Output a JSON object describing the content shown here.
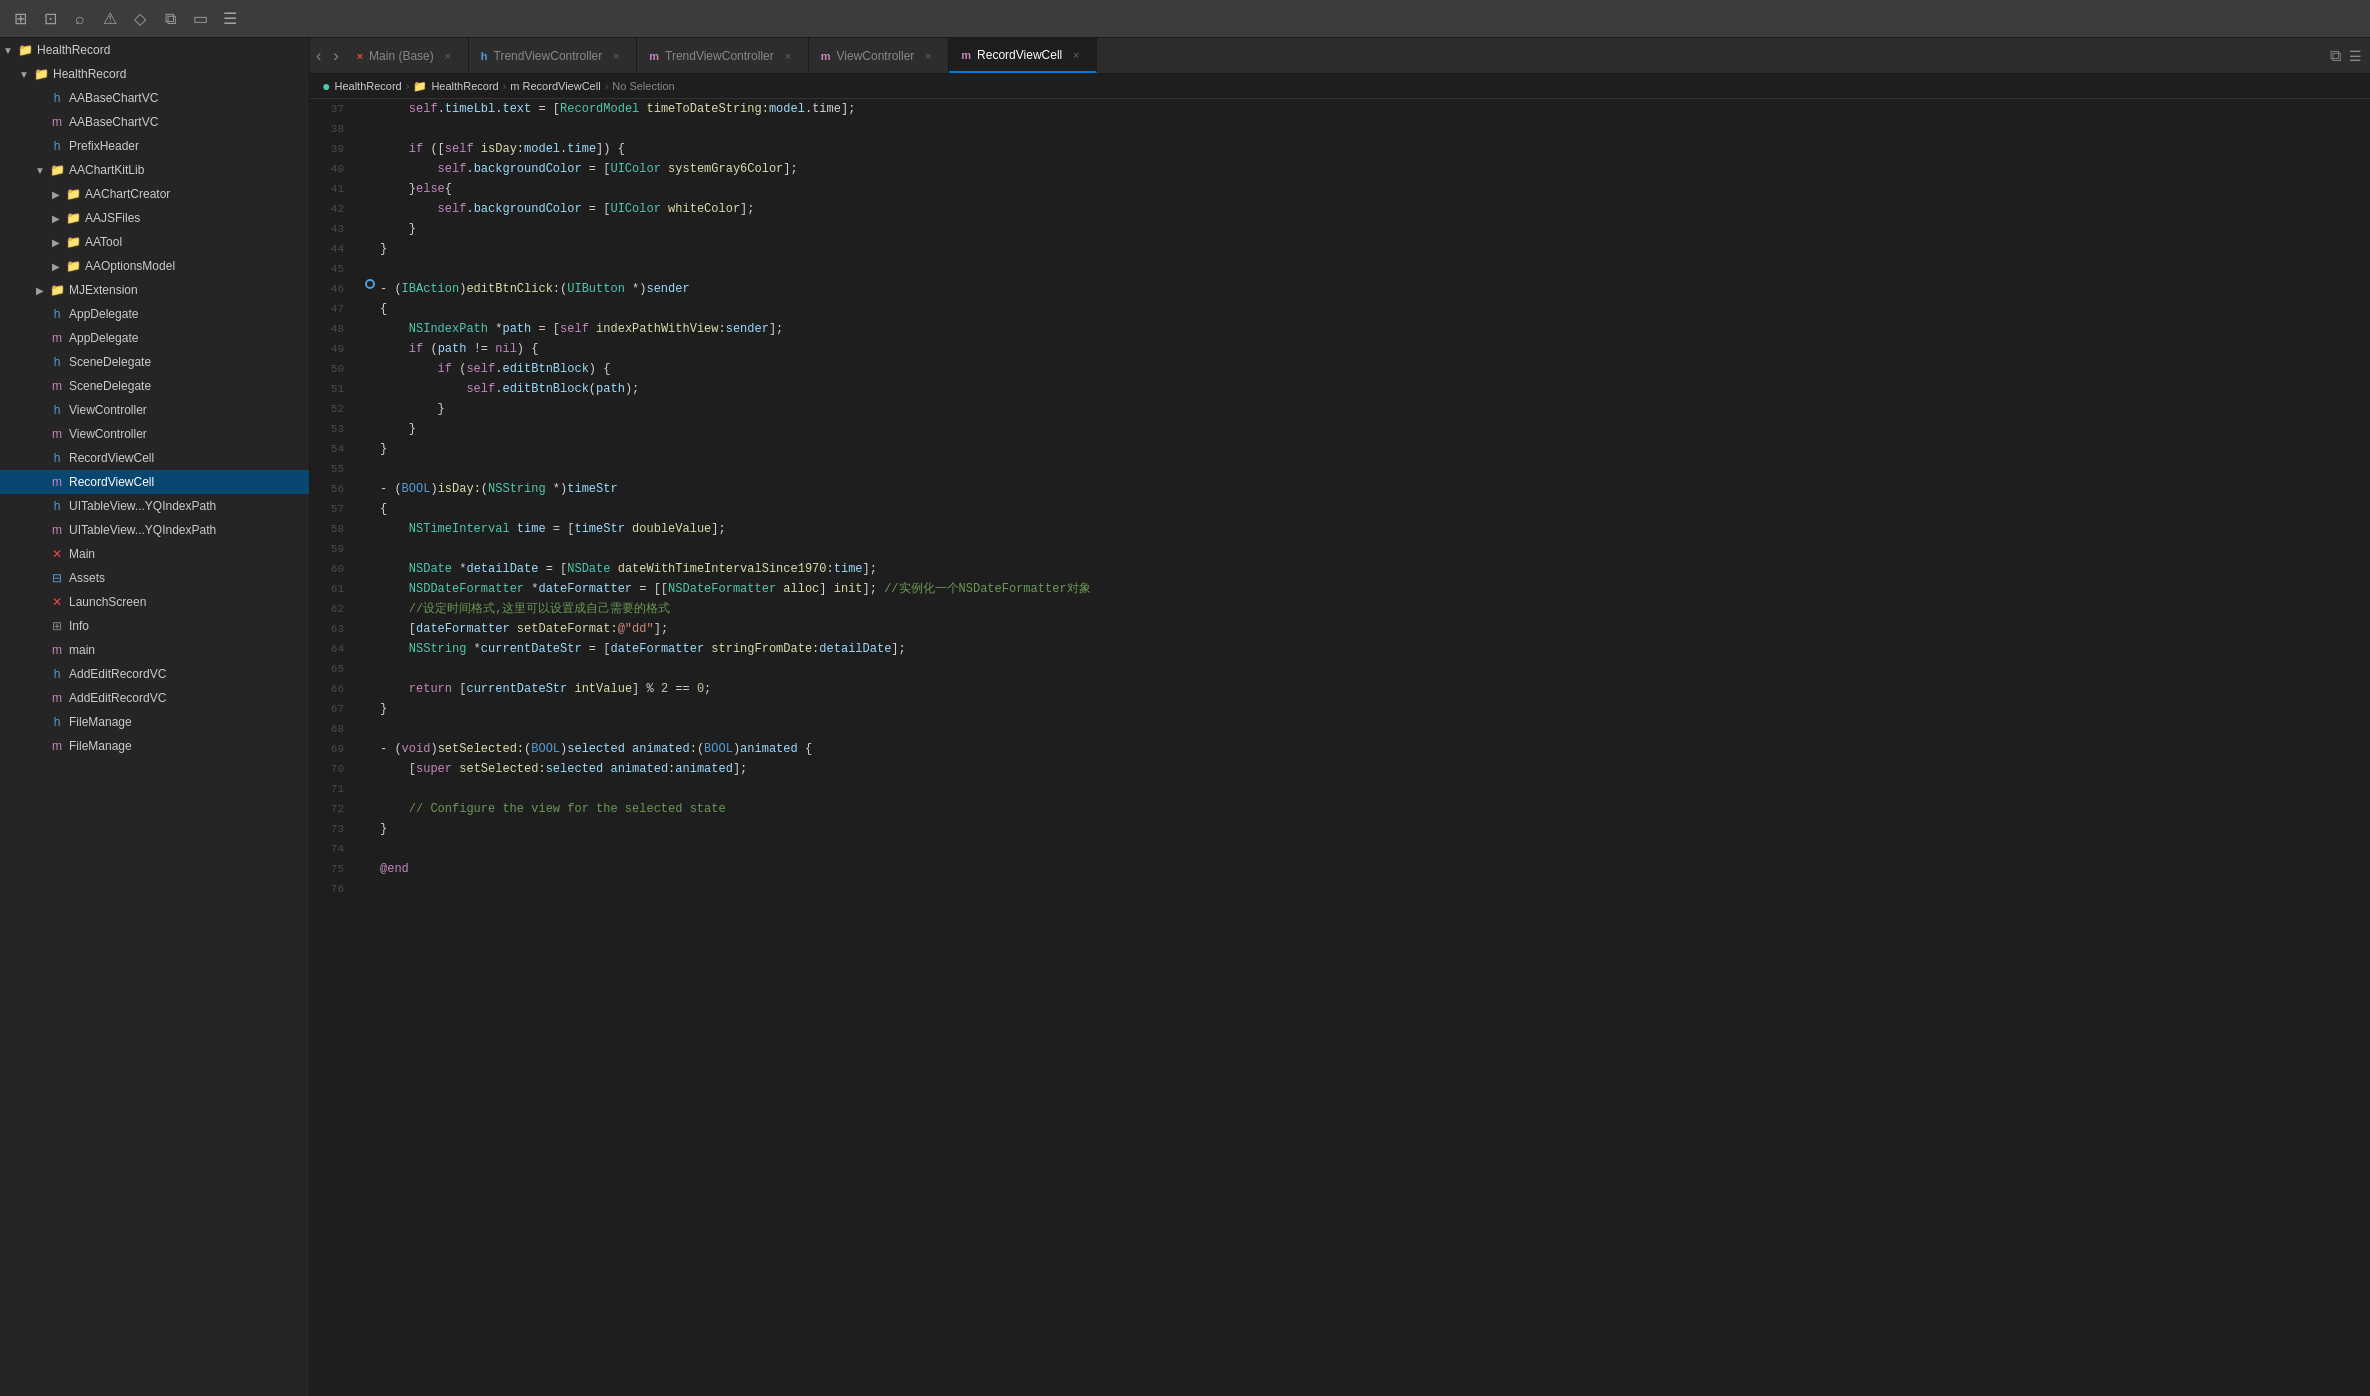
{
  "toolbar": {
    "icons": [
      "square-grid-icon",
      "layout-icon",
      "search-icon",
      "warning-icon",
      "bookmark-icon",
      "code-icon",
      "rect-icon",
      "list-icon"
    ]
  },
  "tabs": [
    {
      "id": "main-base",
      "label": "Main (Base)",
      "icon": "×",
      "prefix": "×",
      "active": false
    },
    {
      "id": "trend-vc-h",
      "label": "TrendViewController",
      "icon": "h",
      "prefix": "h",
      "active": false
    },
    {
      "id": "trend-vc-m",
      "label": "TrendViewController",
      "icon": "m",
      "prefix": "m",
      "active": false
    },
    {
      "id": "view-vc",
      "label": "ViewController",
      "icon": "m",
      "prefix": "m",
      "active": false
    },
    {
      "id": "record-vc",
      "label": "RecordViewCell",
      "icon": "m",
      "prefix": "m",
      "active": true
    }
  ],
  "breadcrumb": {
    "parts": [
      "HealthRecord",
      "HealthRecord",
      "m RecordViewCell",
      "No Selection"
    ]
  },
  "sidebar": {
    "project_name": "HealthRecord",
    "items": [
      {
        "id": "healthrecord-root",
        "label": "HealthRecord",
        "indent": 0,
        "icon": "folder",
        "arrow": "▼",
        "type": "group"
      },
      {
        "id": "healthrecord-folder",
        "label": "HealthRecord",
        "indent": 1,
        "icon": "folder",
        "arrow": "▼",
        "type": "folder"
      },
      {
        "id": "aabases-h",
        "label": "AABaseChartVC",
        "indent": 2,
        "icon": "h",
        "arrow": "",
        "type": "h-file"
      },
      {
        "id": "aabases-m",
        "label": "AABaseChartVC",
        "indent": 2,
        "icon": "m",
        "arrow": "",
        "type": "m-file"
      },
      {
        "id": "prefix-header",
        "label": "PrefixHeader",
        "indent": 2,
        "icon": "h",
        "arrow": "",
        "type": "h-file"
      },
      {
        "id": "aachartkit-folder",
        "label": "AAChartKitLib",
        "indent": 2,
        "icon": "folder",
        "arrow": "▼",
        "type": "folder"
      },
      {
        "id": "aachartcreator",
        "label": "AAChartCreator",
        "indent": 3,
        "icon": "folder",
        "arrow": "▶",
        "type": "folder"
      },
      {
        "id": "aajs-files",
        "label": "AAJSFiles",
        "indent": 3,
        "icon": "folder-orange",
        "arrow": "▶",
        "type": "folder-orange"
      },
      {
        "id": "aatool",
        "label": "AATool",
        "indent": 3,
        "icon": "folder",
        "arrow": "▶",
        "type": "folder"
      },
      {
        "id": "aaoptions",
        "label": "AAOptionsModel",
        "indent": 3,
        "icon": "folder",
        "arrow": "▶",
        "type": "folder"
      },
      {
        "id": "mjextension",
        "label": "MJExtension",
        "indent": 2,
        "icon": "folder",
        "arrow": "▶",
        "type": "folder"
      },
      {
        "id": "appdelegate-h",
        "label": "AppDelegate",
        "indent": 2,
        "icon": "h",
        "arrow": "",
        "type": "h-file"
      },
      {
        "id": "appdelegate-m",
        "label": "AppDelegate",
        "indent": 2,
        "icon": "m",
        "arrow": "",
        "type": "m-file"
      },
      {
        "id": "scenedelegate-h",
        "label": "SceneDelegate",
        "indent": 2,
        "icon": "h",
        "arrow": "",
        "type": "h-file"
      },
      {
        "id": "scenedelegate-m",
        "label": "SceneDelegate",
        "indent": 2,
        "icon": "m",
        "arrow": "",
        "type": "m-file"
      },
      {
        "id": "viewcontroller-h",
        "label": "ViewController",
        "indent": 2,
        "icon": "h",
        "arrow": "",
        "type": "h-file"
      },
      {
        "id": "viewcontroller-m",
        "label": "ViewController",
        "indent": 2,
        "icon": "m",
        "arrow": "",
        "type": "m-file"
      },
      {
        "id": "recordviewcell-h",
        "label": "RecordViewCell",
        "indent": 2,
        "icon": "h",
        "arrow": "",
        "type": "h-file"
      },
      {
        "id": "recordviewcell-m",
        "label": "RecordViewCell",
        "indent": 2,
        "icon": "m",
        "arrow": "",
        "type": "m-file",
        "selected": true
      },
      {
        "id": "uitableview-1",
        "label": "UITableView...YQIndexPath",
        "indent": 2,
        "icon": "h",
        "arrow": "",
        "type": "h-file"
      },
      {
        "id": "uitableview-2",
        "label": "UITableView...YQIndexPath",
        "indent": 2,
        "icon": "m",
        "arrow": "",
        "type": "m-file"
      },
      {
        "id": "main-x",
        "label": "Main",
        "indent": 2,
        "icon": "x",
        "arrow": "",
        "type": "x-file"
      },
      {
        "id": "assets",
        "label": "Assets",
        "indent": 2,
        "icon": "assets",
        "arrow": "",
        "type": "assets"
      },
      {
        "id": "launchscreen",
        "label": "LaunchScreen",
        "indent": 2,
        "icon": "x",
        "arrow": "",
        "type": "x-file"
      },
      {
        "id": "info",
        "label": "Info",
        "indent": 2,
        "icon": "list",
        "arrow": "",
        "type": "list-file"
      },
      {
        "id": "main-m",
        "label": "main",
        "indent": 2,
        "icon": "m",
        "arrow": "",
        "type": "m-file"
      },
      {
        "id": "addeditrecordvc-h",
        "label": "AddEditRecordVC",
        "indent": 2,
        "icon": "h",
        "arrow": "",
        "type": "h-file"
      },
      {
        "id": "addeditrecordvc-m",
        "label": "AddEditRecordVC",
        "indent": 2,
        "icon": "m",
        "arrow": "",
        "type": "m-file"
      },
      {
        "id": "filemanage-h",
        "label": "FileManage",
        "indent": 2,
        "icon": "h",
        "arrow": "",
        "type": "h-file"
      },
      {
        "id": "filemanage-m",
        "label": "FileManage",
        "indent": 2,
        "icon": "m",
        "arrow": "",
        "type": "m-file"
      }
    ]
  },
  "code": {
    "lines": [
      {
        "num": 37,
        "content": "    self.timeLbl.text = [RecordModel timeToDateString:model.time];"
      },
      {
        "num": 38,
        "content": ""
      },
      {
        "num": 39,
        "content": "    if ([self isDay:model.time]) {"
      },
      {
        "num": 40,
        "content": "        self.backgroundColor = [UIColor systemGray6Color];"
      },
      {
        "num": 41,
        "content": "    }else{"
      },
      {
        "num": 42,
        "content": "        self.backgroundColor = [UIColor whiteColor];"
      },
      {
        "num": 43,
        "content": "    }"
      },
      {
        "num": 44,
        "content": "}"
      },
      {
        "num": 45,
        "content": ""
      },
      {
        "num": 46,
        "content": "- (IBAction)editBtnClick:(UIButton *)sender",
        "has_bullet": true
      },
      {
        "num": 47,
        "content": "{"
      },
      {
        "num": 48,
        "content": "    NSIndexPath *path = [self indexPathWithView:sender];"
      },
      {
        "num": 49,
        "content": "    if (path != nil) {"
      },
      {
        "num": 50,
        "content": "        if (self.editBtnBlock) {"
      },
      {
        "num": 51,
        "content": "            self.editBtnBlock(path);"
      },
      {
        "num": 52,
        "content": "        }"
      },
      {
        "num": 53,
        "content": "    }"
      },
      {
        "num": 54,
        "content": "}"
      },
      {
        "num": 55,
        "content": ""
      },
      {
        "num": 56,
        "content": "- (BOOL)isDay:(NSString *)timeStr"
      },
      {
        "num": 57,
        "content": "{"
      },
      {
        "num": 58,
        "content": "    NSTimeInterval time = [timeStr doubleValue];"
      },
      {
        "num": 59,
        "content": ""
      },
      {
        "num": 60,
        "content": "    NSDate *detailDate = [NSDate dateWithTimeIntervalSince1970:time];"
      },
      {
        "num": 61,
        "content": "    NSDDateFormatter *dateFormatter = [[NSDateFormatter alloc] init]; //实例化一个NSDateFormatter对象"
      },
      {
        "num": 62,
        "content": "    //设定时间格式,这里可以设置成自己需要的格式"
      },
      {
        "num": 63,
        "content": "    [dateFormatter setDateFormat:@\"dd\"];"
      },
      {
        "num": 64,
        "content": "    NSString *currentDateStr = [dateFormatter stringFromDate:detailDate];"
      },
      {
        "num": 65,
        "content": ""
      },
      {
        "num": 66,
        "content": "    return [currentDateStr intValue] % 2 == 0;"
      },
      {
        "num": 67,
        "content": "}"
      },
      {
        "num": 68,
        "content": ""
      },
      {
        "num": 69,
        "content": "- (void)setSelected:(BOOL)selected animated:(BOOL)animated {"
      },
      {
        "num": 70,
        "content": "    [super setSelected:selected animated:animated];"
      },
      {
        "num": 71,
        "content": ""
      },
      {
        "num": 72,
        "content": "    // Configure the view for the selected state"
      },
      {
        "num": 73,
        "content": "}"
      },
      {
        "num": 74,
        "content": ""
      },
      {
        "num": 75,
        "content": "@end"
      },
      {
        "num": 76,
        "content": ""
      }
    ]
  }
}
